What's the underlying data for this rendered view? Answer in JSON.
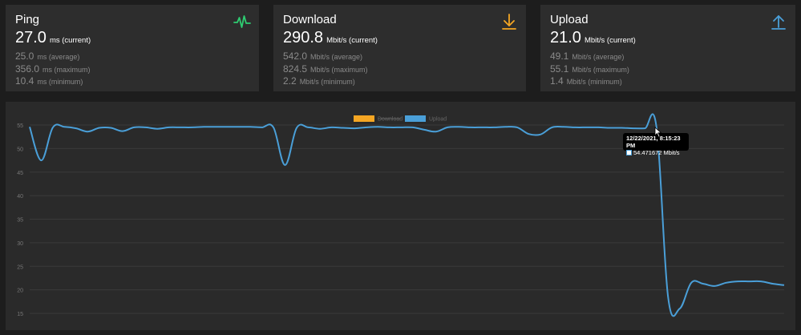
{
  "cards": [
    {
      "title": "Ping",
      "current": "27.0",
      "current_unit": "ms (current)",
      "avg": "25.0",
      "avg_unit": "ms (average)",
      "max": "356.0",
      "max_unit": "ms (maximum)",
      "min": "10.4",
      "min_unit": "ms (minimum)",
      "icon": "pulse-icon",
      "color": "#2ecc71"
    },
    {
      "title": "Download",
      "current": "290.8",
      "current_unit": "Mbit/s (current)",
      "avg": "542.0",
      "avg_unit": "Mbit/s (average)",
      "max": "824.5",
      "max_unit": "Mbit/s (maximum)",
      "min": "2.2",
      "min_unit": "Mbit/s (minimum)",
      "icon": "download-arrow-icon",
      "color": "#f5a623"
    },
    {
      "title": "Upload",
      "current": "21.0",
      "current_unit": "Mbit/s (current)",
      "avg": "49.1",
      "avg_unit": "Mbit/s (average)",
      "max": "55.1",
      "max_unit": "Mbit/s (maximum)",
      "min": "1.4",
      "min_unit": "Mbit/s (minimum)",
      "icon": "upload-arrow-icon",
      "color": "#4a9fd8"
    }
  ],
  "tooltip": {
    "title": "12/22/2021, 8:15:23 PM",
    "value": "54.471672 Mbit/s"
  },
  "chart_data": {
    "type": "line",
    "legend": [
      {
        "name": "Download",
        "color": "#f5a623",
        "hidden": true
      },
      {
        "name": "Upload",
        "color": "#4a9fd8",
        "hidden": false
      }
    ],
    "legend_position": "top-center",
    "ylim": [
      13,
      57
    ],
    "yticks": [
      "55",
      "50",
      "45",
      "40",
      "35",
      "30",
      "25",
      "20",
      "15"
    ],
    "grid": true,
    "series": [
      {
        "name": "Upload",
        "color": "#4a9fd8",
        "values": [
          54.6,
          47.5,
          54.5,
          54.6,
          54.3,
          53.6,
          54.4,
          54.4,
          53.7,
          54.5,
          54.5,
          54.2,
          54.5,
          54.5,
          54.5,
          54.6,
          54.6,
          54.6,
          54.6,
          54.6,
          54.5,
          54.5,
          46.5,
          54.4,
          54.5,
          54.2,
          54.5,
          54.4,
          54.3,
          54.5,
          54.6,
          54.5,
          54.5,
          54.5,
          54.0,
          53.6,
          54.5,
          54.6,
          54.5,
          54.5,
          54.5,
          54.6,
          54.5,
          53.1,
          53.0,
          54.5,
          54.6,
          54.5,
          54.5,
          54.5,
          54.4,
          54.4,
          54.3,
          54.3,
          54.5,
          18.5,
          16.0,
          21.5,
          21.3,
          20.8,
          21.5,
          21.8,
          21.8,
          21.8,
          21.3,
          21.0
        ]
      }
    ]
  }
}
